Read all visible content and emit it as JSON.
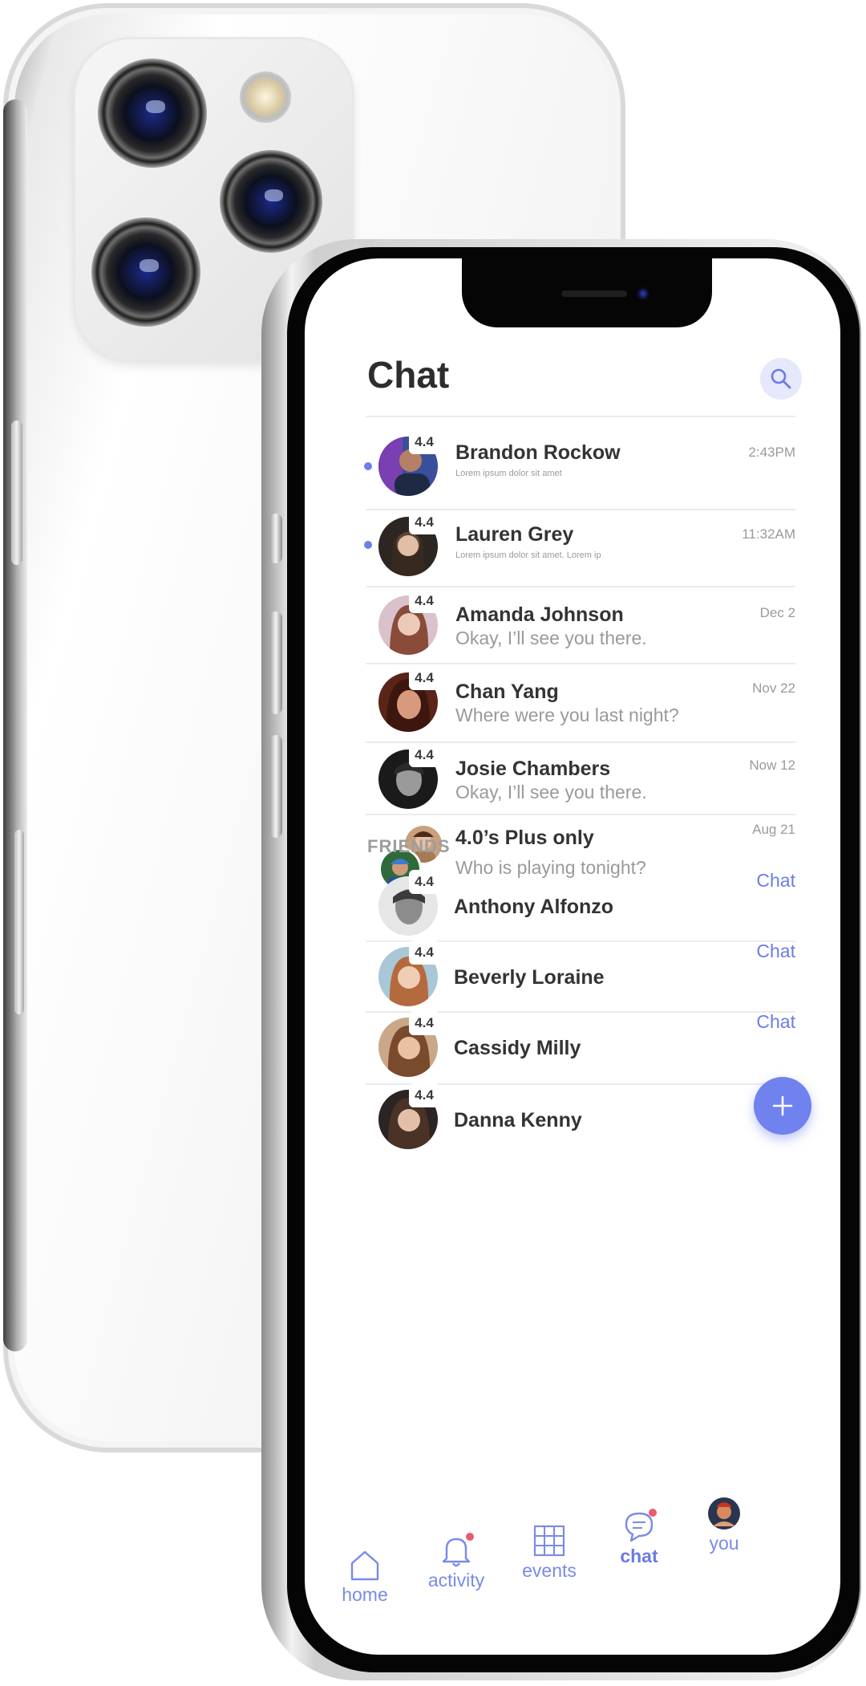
{
  "screen": {
    "title": "Chat",
    "search_icon": "search-icon"
  },
  "chats": [
    {
      "name": "Brandon Rockow",
      "preview": "Lorem ipsum dolor sit amet",
      "time": "2:43PM",
      "rating": "4.4",
      "unread": true
    },
    {
      "name": "Lauren Grey",
      "preview": "Lorem ipsum dolor sit amet. Lorem ip",
      "time": "11:32AM",
      "rating": "4.4",
      "unread": true
    },
    {
      "name": "Amanda Johnson",
      "preview": "Okay, I’ll see you there.",
      "time": "Dec 2",
      "rating": "4.4",
      "unread": false
    },
    {
      "name": "Chan Yang",
      "preview": "Where were you last night?",
      "time": "Nov 22",
      "rating": "4.4",
      "unread": false
    },
    {
      "name": "Josie Chambers",
      "preview": "Okay, I’ll see you there.",
      "time": "Now 12",
      "rating": "4.4",
      "unread": false
    },
    {
      "name": "4.0’s Plus only",
      "preview": "Who is playing tonight?",
      "time": "Aug 21",
      "group": true
    }
  ],
  "friends_section": {
    "label": "FRIENDS",
    "chat_label": "Chat",
    "friends": [
      {
        "name": "Anthony Alfonzo",
        "rating": "4.4"
      },
      {
        "name": "Beverly Loraine",
        "rating": "4.4"
      },
      {
        "name": "Cassidy Milly",
        "rating": "4.4"
      },
      {
        "name": "Danna Kenny",
        "rating": "4.4"
      }
    ]
  },
  "fab": {
    "icon": "plus-icon"
  },
  "tabbar": [
    {
      "label": "home",
      "icon": "home-icon"
    },
    {
      "label": "activity",
      "icon": "bell-icon",
      "badge": true
    },
    {
      "label": "events",
      "icon": "calendar-grid-icon"
    },
    {
      "label": "chat",
      "icon": "chat-bubble-icon",
      "badge": true,
      "active": true
    },
    {
      "label": "you",
      "icon": "avatar-icon"
    }
  ],
  "colors": {
    "accent": "#6f82ee",
    "badge": "#ef5a6e",
    "text_dark": "#333333",
    "text_muted": "#9a9a9a"
  }
}
